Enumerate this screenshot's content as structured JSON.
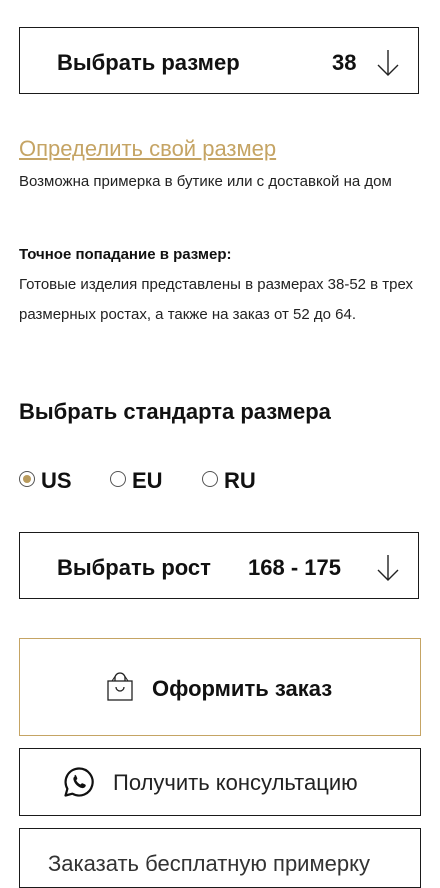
{
  "size_select": {
    "label": "Выбрать размер",
    "value": "38",
    "icon": "arrow-down-icon"
  },
  "size_link": "Определить свой размер",
  "fitting_text": "Возможна примерка в бутике или с доставкой на дом",
  "precise": {
    "title": "Точное попадание в размер:",
    "text": "Готовые изделия представлены в размерах 38-52 в трех размерных ростах, а также на заказ от 52 до 64."
  },
  "standard": {
    "heading": "Выбрать стандарта размера",
    "options": [
      {
        "label": "US",
        "selected": true
      },
      {
        "label": "EU",
        "selected": false
      },
      {
        "label": "RU",
        "selected": false
      }
    ]
  },
  "height_select": {
    "label": "Выбрать рост",
    "value": "168 - 175",
    "icon": "arrow-down-icon"
  },
  "order_button": {
    "label": "Оформить заказ",
    "icon": "shopping-bag-icon"
  },
  "consult_button": {
    "label": "Получить консультацию",
    "icon": "whatsapp-icon"
  },
  "trial_button": {
    "label": "Заказать бесплатную примерку"
  },
  "colors": {
    "accent": "#c5a464",
    "radio_selected": "#b89a5c",
    "border": "#1a1a1a"
  }
}
